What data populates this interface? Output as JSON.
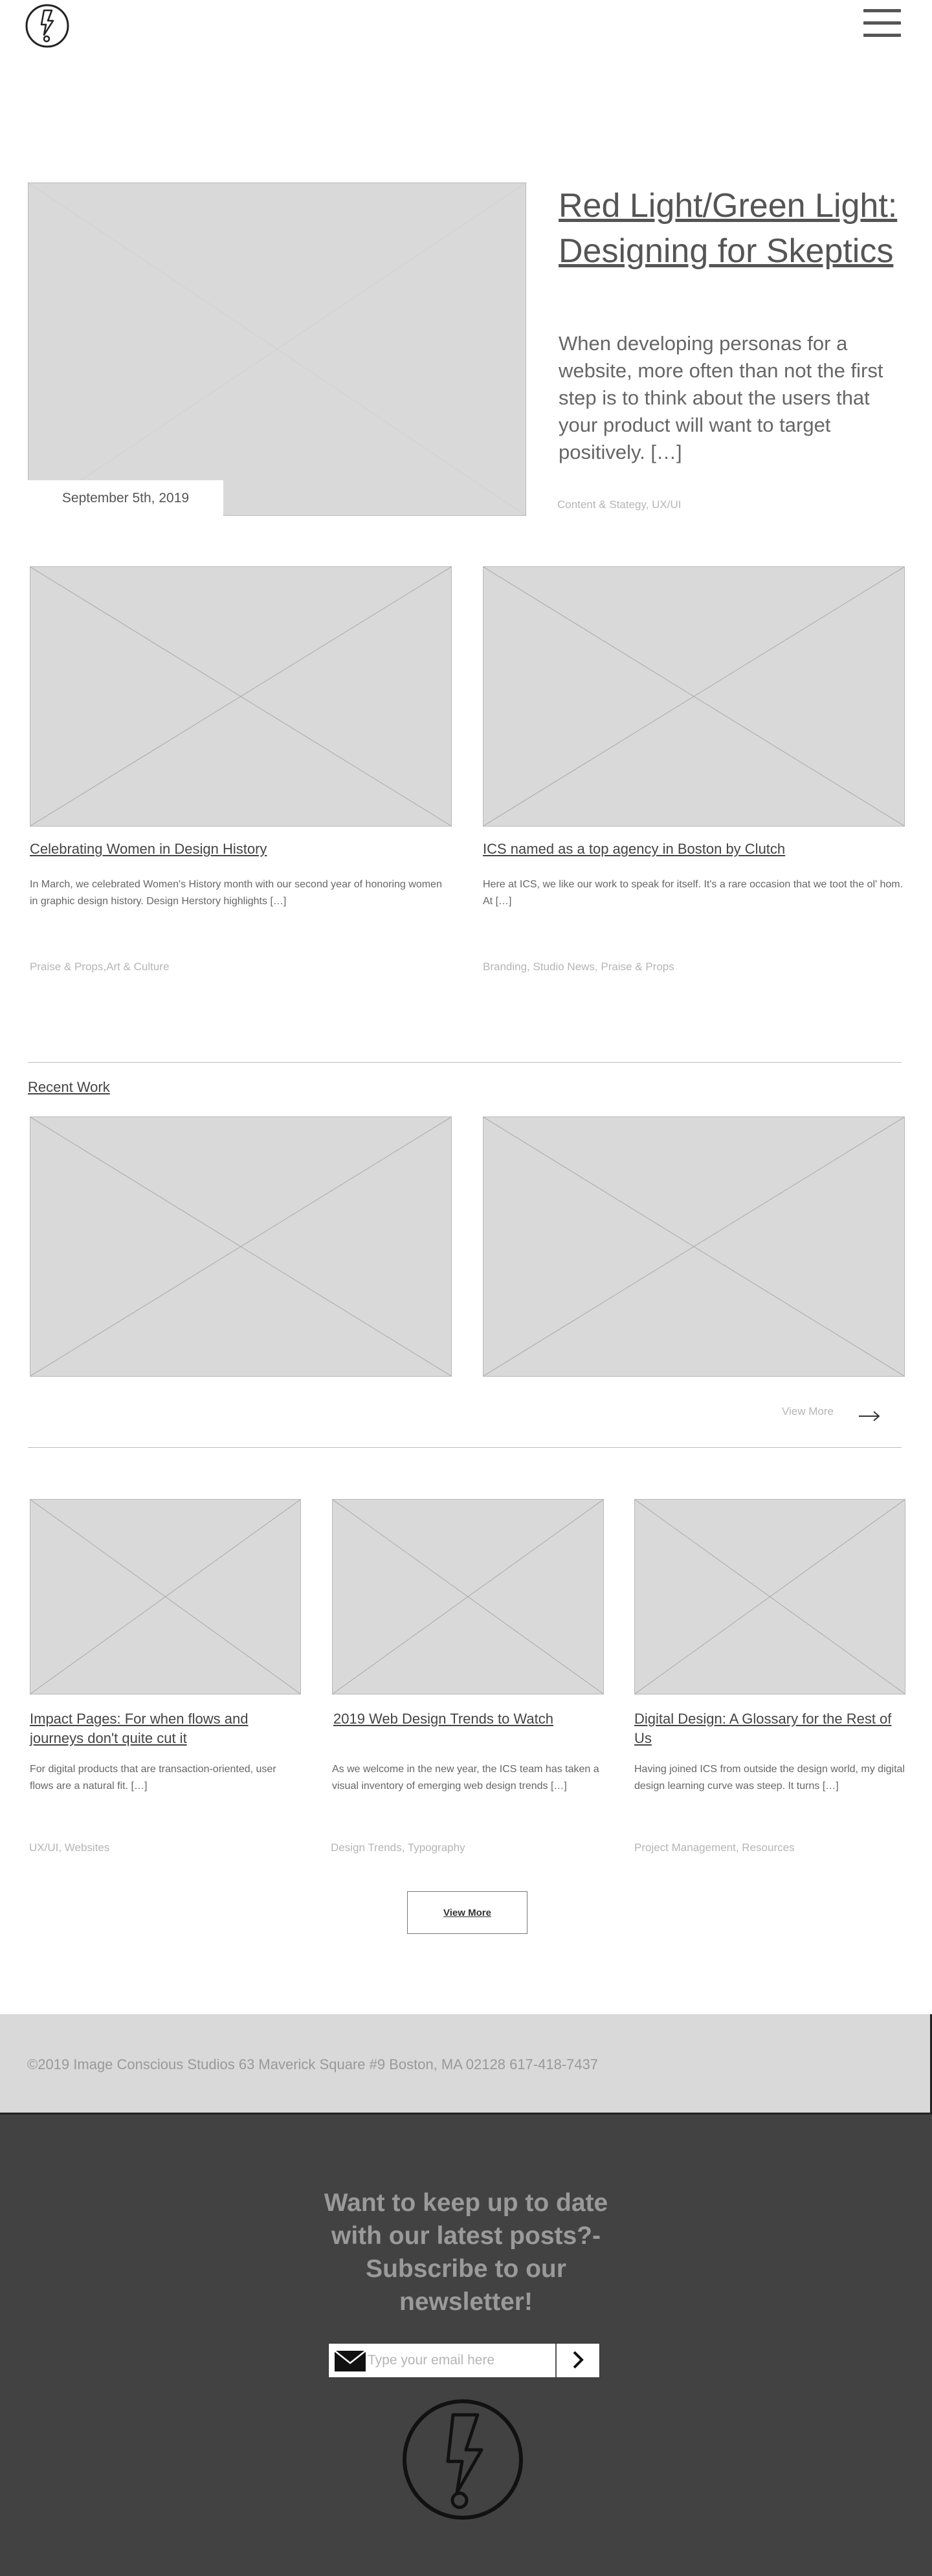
{
  "header": {
    "logo_icon": "lightning-bolt-logo",
    "menu_icon": "hamburger-icon"
  },
  "hero": {
    "title": "Red Light/Green Light: Designing for Skeptics",
    "excerpt": "When developing personas for a website, more often than not the first step is to think about the users that your product will want to target positively. […]",
    "date": "September 5th, 2019",
    "categories": "Content & Stategy, UX/UI"
  },
  "featured_posts": [
    {
      "title": "Celebrating Women in Design History",
      "excerpt": "In March, we celebrated Women's History month with our second year of honoring women in graphic design history. Design Herstory highlights […]",
      "categories": "Praise & Props,Art & Culture"
    },
    {
      "title": "ICS named as a top agency in Boston by Clutch",
      "excerpt": "Here at ICS, we like our work to speak for itself. It's a rare occasion that we toot the ol' hom. At […]",
      "categories": "Branding, Studio News, Praise & Props"
    }
  ],
  "recent_work": {
    "title": "Recent Work",
    "view_more": "View More"
  },
  "posts": [
    {
      "title": "Impact Pages: For when flows and journeys don't quite cut it",
      "excerpt": "For digital products that are transaction-oriented, user flows are a natural fit. […]",
      "categories": "UX/UI, Websites"
    },
    {
      "title": "2019 Web Design Trends to Watch",
      "excerpt": "As we welcome in the new year, the ICS team has taken a visual inventory of emerging web design trends […]",
      "categories": "Design Trends, Typography"
    },
    {
      "title": "Digital Design: A Glossary for the Rest of Us",
      "excerpt": "Having joined ICS from outside the design world, my digital design learning curve was steep. It turns […]",
      "categories": "Project Management, Resources"
    }
  ],
  "view_more_button": "View More",
  "footer": {
    "text": "©2019 Image Conscious Studios 63 Maverick Square #9 Boston, MA 02128 617-418-7437"
  },
  "newsletter": {
    "title": "Want to keep up to date with our latest posts?-Subscribe to our newsletter!",
    "placeholder": "Type your email here",
    "mail_icon": "envelope-icon",
    "submit_icon": "chevron-right-icon"
  },
  "colors": {
    "placeholder_bg": "#d9d9d9",
    "footer_band": "#d9d9d9",
    "newsletter_bg": "#424242",
    "muted_text": "#b5b5b5"
  }
}
